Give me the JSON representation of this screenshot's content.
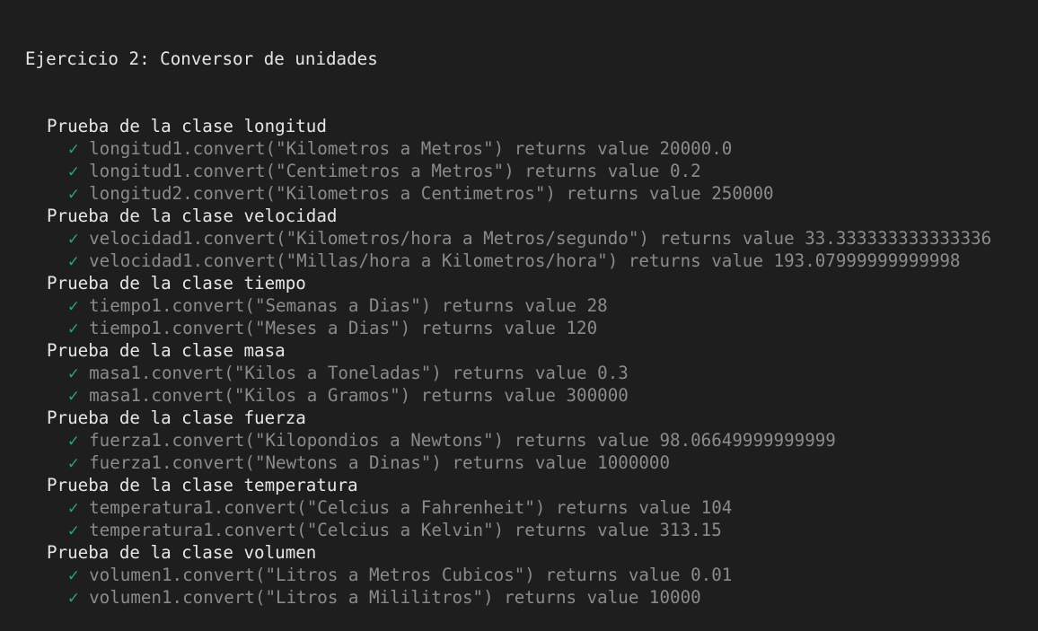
{
  "title": "Ejercicio 2: Conversor de unidades",
  "check_symbol": "✓",
  "colors": {
    "background": "#1e1e1e",
    "heading_text": "#e6e6e6",
    "test_text": "#8b8b8b",
    "check": "#23a87a"
  },
  "suites": [
    {
      "name": "Prueba de la clase longitud",
      "tests": [
        "longitud1.convert(\"Kilometros a Metros\") returns value 20000.0",
        "longitud1.convert(\"Centimetros a Metros\") returns value 0.2",
        "longitud2.convert(\"Kilometros a Centimetros\") returns value 250000"
      ]
    },
    {
      "name": "Prueba de la clase velocidad",
      "tests": [
        "velocidad1.convert(\"Kilometros/hora a Metros/segundo\") returns value 33.333333333333336",
        "velocidad1.convert(\"Millas/hora a Kilometros/hora\") returns value 193.07999999999998"
      ]
    },
    {
      "name": "Prueba de la clase tiempo",
      "tests": [
        "tiempo1.convert(\"Semanas a Dias\") returns value 28",
        "tiempo1.convert(\"Meses a Dias\") returns value 120"
      ]
    },
    {
      "name": "Prueba de la clase masa",
      "tests": [
        "masa1.convert(\"Kilos a Toneladas\") returns value 0.3",
        "masa1.convert(\"Kilos a Gramos\") returns value 300000"
      ]
    },
    {
      "name": "Prueba de la clase fuerza",
      "tests": [
        "fuerza1.convert(\"Kilopondios a Newtons\") returns value 98.06649999999999",
        "fuerza1.convert(\"Newtons a Dinas\") returns value 1000000"
      ]
    },
    {
      "name": "Prueba de la clase temperatura",
      "tests": [
        "temperatura1.convert(\"Celcius a Fahrenheit\") returns value 104",
        "temperatura1.convert(\"Celcius a Kelvin\") returns value 313.15"
      ]
    },
    {
      "name": "Prueba de la clase volumen",
      "tests": [
        "volumen1.convert(\"Litros a Metros Cubicos\") returns value 0.01",
        "volumen1.convert(\"Litros a Mililitros\") returns value 10000"
      ]
    }
  ]
}
